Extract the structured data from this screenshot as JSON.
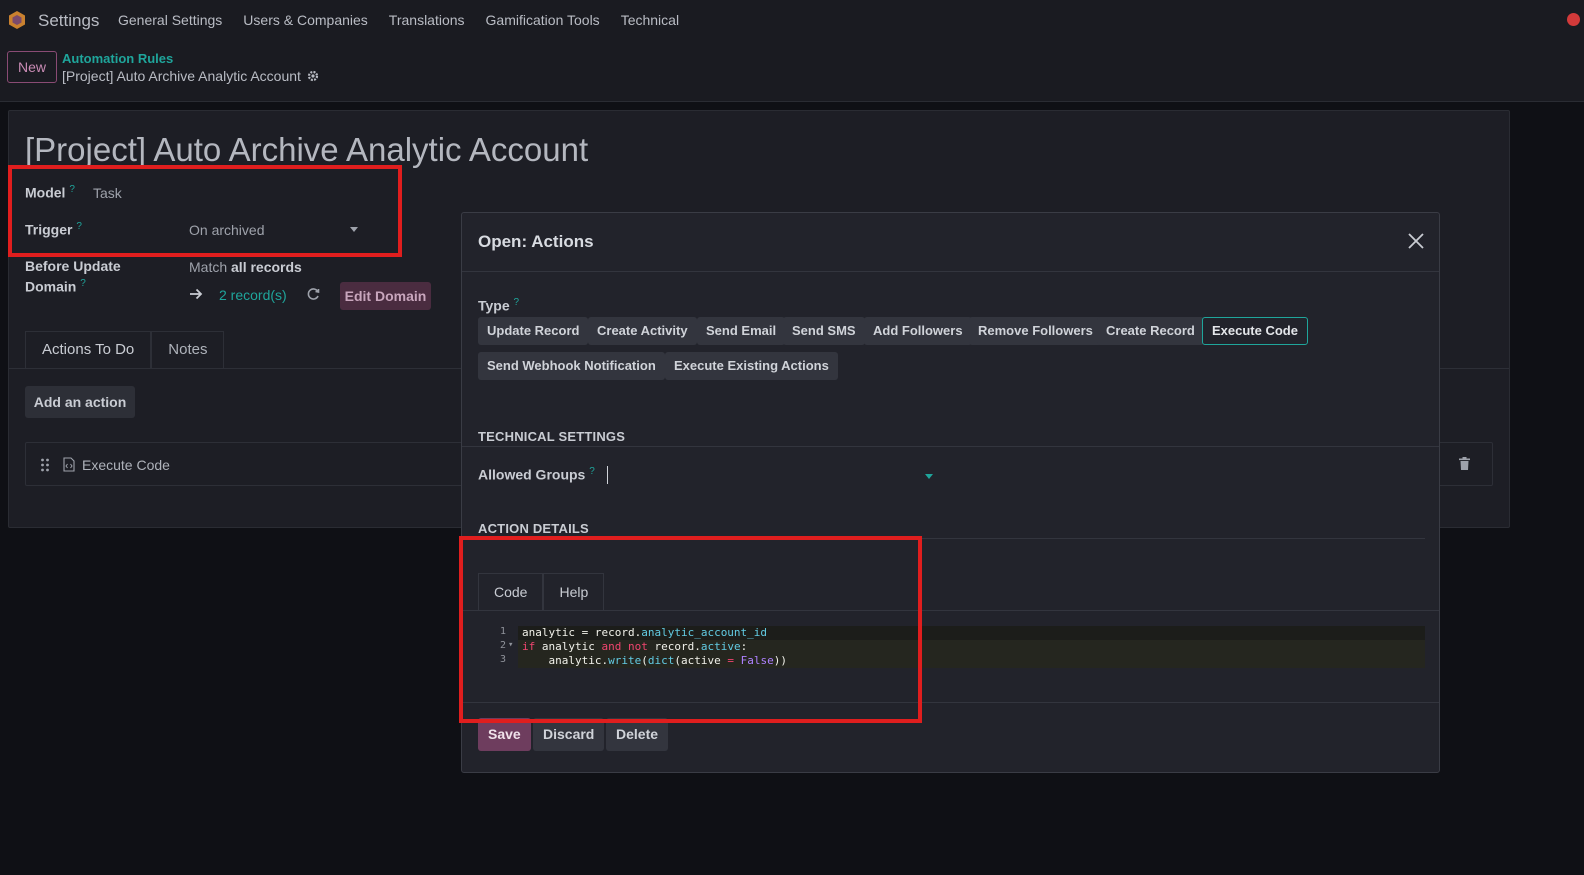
{
  "navbar": {
    "app_name": "Settings",
    "menu": [
      "General Settings",
      "Users & Companies",
      "Translations",
      "Gamification Tools",
      "Technical"
    ]
  },
  "control_panel": {
    "new_label": "New",
    "breadcrumb_parent": "Automation Rules",
    "breadcrumb_current": "[Project] Auto Archive Analytic Account"
  },
  "form": {
    "title": "[Project] Auto Archive Analytic Account",
    "model_label": "Model",
    "model_value": "Task",
    "trigger_label": "Trigger",
    "trigger_value": "On archived",
    "before_update_label_1": "Before Update",
    "before_update_label_2": "Domain",
    "match_prefix": "Match",
    "match_bold": "all records",
    "records_count": "2 record(s)",
    "edit_domain": "Edit Domain",
    "tabs": [
      "Actions To Do",
      "Notes"
    ],
    "add_action": "Add an action",
    "action_item": "Execute Code"
  },
  "modal": {
    "title": "Open: Actions",
    "type_label": "Type",
    "type_options": [
      "Update Record",
      "Create Activity",
      "Send Email",
      "Send SMS",
      "Add Followers",
      "Remove Followers",
      "Create Record",
      "Execute Code",
      "Send Webhook Notification",
      "Execute Existing Actions"
    ],
    "selected_type": "Execute Code",
    "technical_settings": "TECHNICAL SETTINGS",
    "allowed_groups_label": "Allowed Groups",
    "action_details": "ACTION DETAILS",
    "code_tabs": [
      "Code",
      "Help"
    ],
    "code_lines": [
      "analytic = record.analytic_account_id",
      "if analytic and not record.active:",
      "    analytic.write(dict(active = False))"
    ],
    "buttons": {
      "save": "Save",
      "discard": "Discard",
      "delete": "Delete"
    }
  },
  "colors": {
    "accent_teal": "#1fa59b",
    "primary_purple": "#6e3d5e",
    "annotation_red": "#e01e1e"
  },
  "icons": [
    "app-logo-icon",
    "gear-icon",
    "arrow-right-icon",
    "refresh-icon",
    "drag-handle-icon",
    "code-file-icon",
    "trash-icon",
    "close-icon"
  ]
}
